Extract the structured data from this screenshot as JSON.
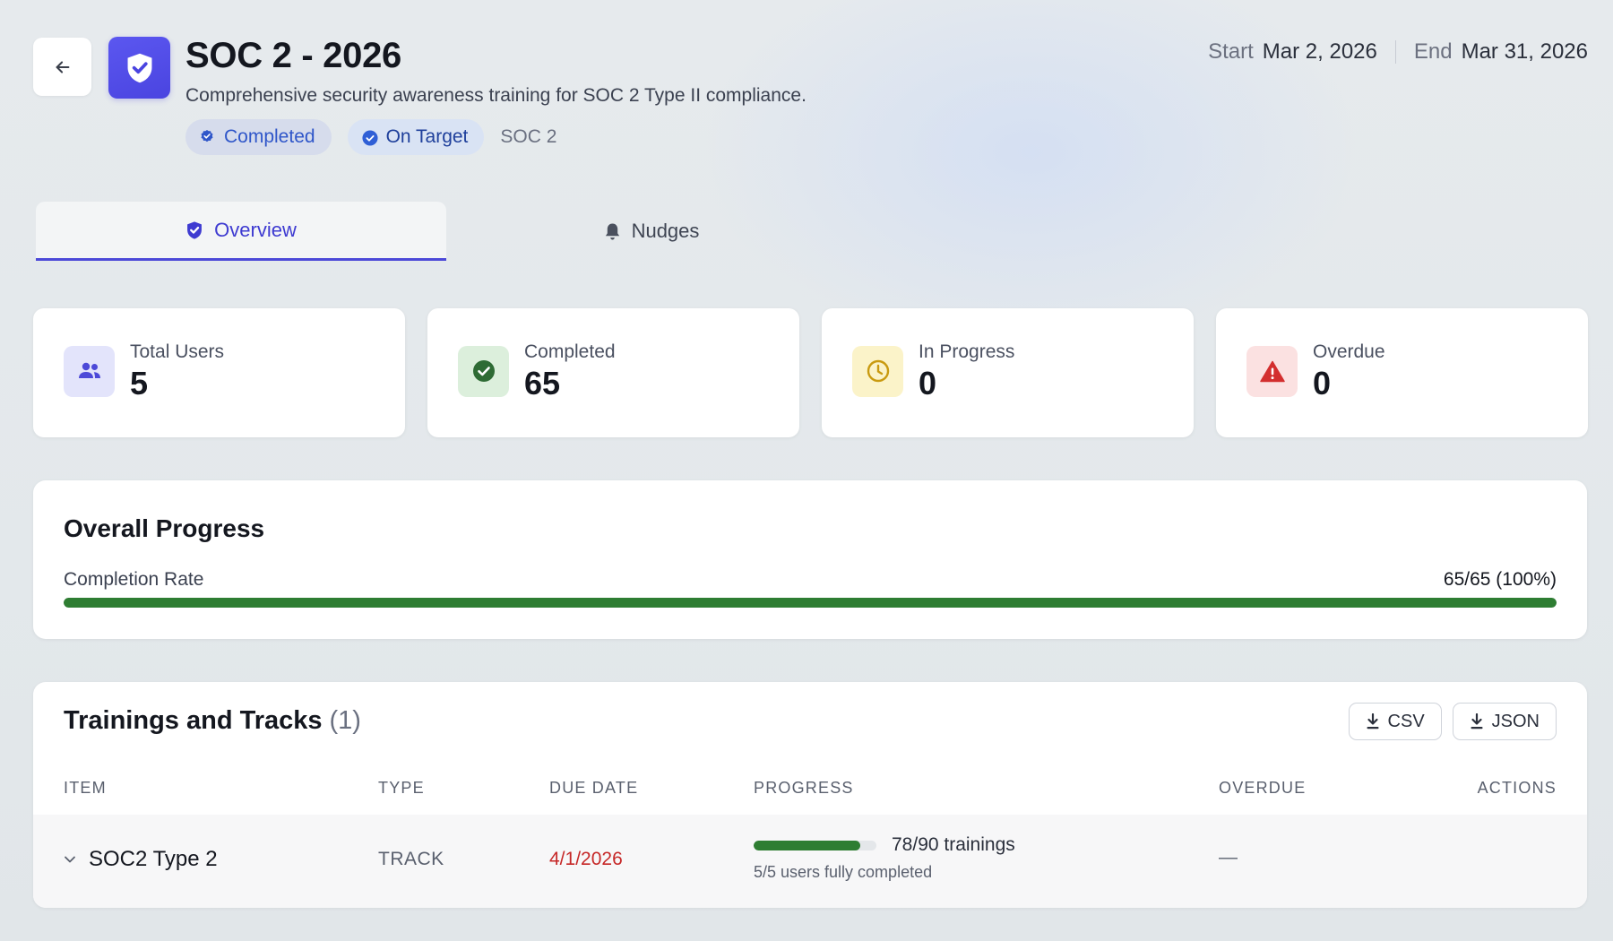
{
  "header": {
    "title": "SOC 2 - 2026",
    "subtitle": "Comprehensive security awareness training for SOC 2 Type II compliance.",
    "badges": {
      "status": "Completed",
      "target": "On Target",
      "framework": "SOC 2"
    },
    "dates": {
      "start_label": "Start",
      "start_value": "Mar 2, 2026",
      "end_label": "End",
      "end_value": "Mar 31, 2026"
    },
    "icons": {
      "back": "arrow-left-icon",
      "logo": "shield-check-icon"
    }
  },
  "tabs": [
    {
      "label": "Overview",
      "icon": "shield-check-icon",
      "active": true
    },
    {
      "label": "Nudges",
      "icon": "bell-icon",
      "active": false
    }
  ],
  "stats": [
    {
      "label": "Total Users",
      "value": "5",
      "icon": "users-icon",
      "color": "#4c49d8"
    },
    {
      "label": "Completed",
      "value": "65",
      "icon": "check-circle-icon",
      "color": "#2e6b34"
    },
    {
      "label": "In Progress",
      "value": "0",
      "icon": "clock-icon",
      "color": "#c99a10"
    },
    {
      "label": "Overdue",
      "value": "0",
      "icon": "warning-triangle-icon",
      "color": "#d32f2f"
    }
  ],
  "overall_progress": {
    "title": "Overall Progress",
    "rate_label": "Completion Rate",
    "rate_value": "65/65 (100%)",
    "fraction": 1.0
  },
  "trainings": {
    "title": "Trainings and Tracks",
    "count": "(1)",
    "export": {
      "csv": "CSV",
      "json": "JSON"
    },
    "columns": [
      "ITEM",
      "TYPE",
      "DUE DATE",
      "PROGRESS",
      "OVERDUE",
      "ACTIONS"
    ],
    "rows": [
      {
        "item": "SOC2 Type 2",
        "type": "TRACK",
        "due_date": "4/1/2026",
        "progress_text": "78/90 trainings",
        "progress_fraction": 0.8667,
        "progress_sub": "5/5 users fully completed",
        "overdue": "—"
      }
    ]
  },
  "colors": {
    "accent": "#4c49d8",
    "success": "#2e7d32",
    "danger": "#c62828"
  }
}
